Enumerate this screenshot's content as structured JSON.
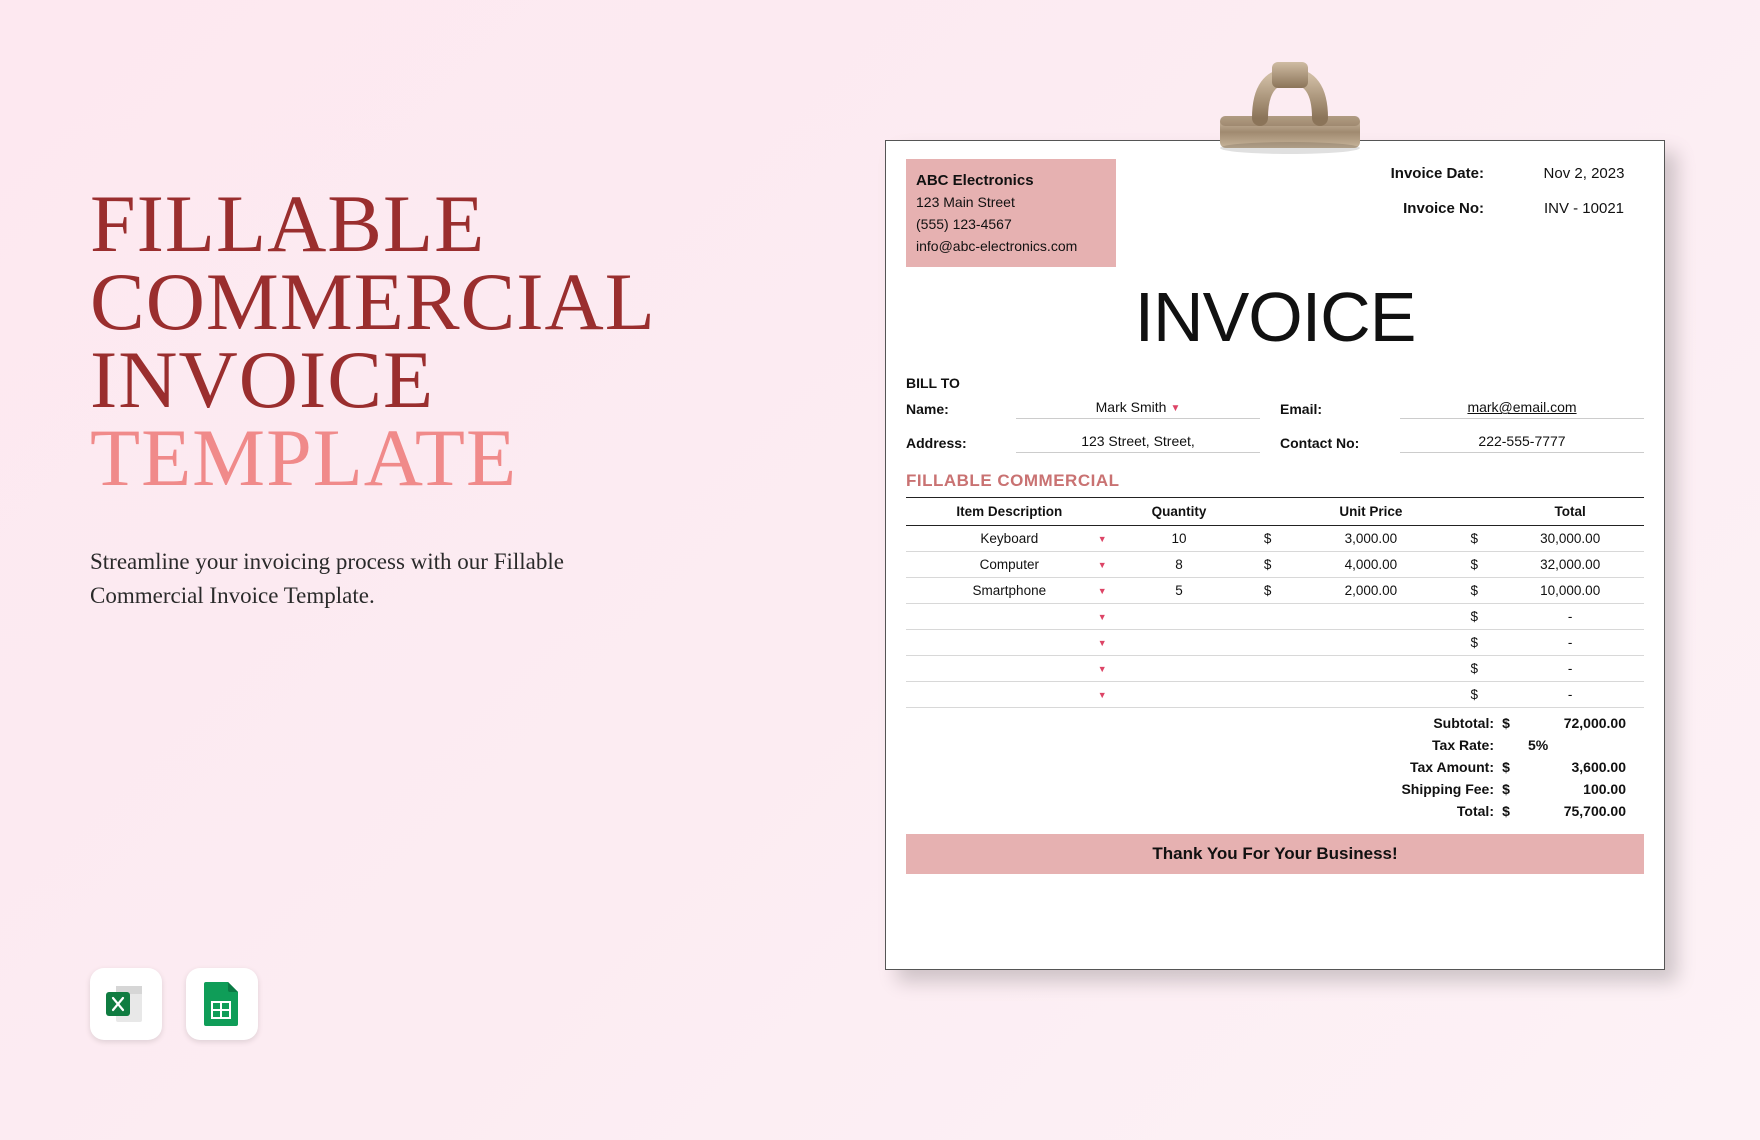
{
  "hero": {
    "line1": "FILLABLE",
    "line2": "COMMERCIAL",
    "line3": "INVOICE",
    "line4": "TEMPLATE",
    "subtitle": "Streamline your invoicing process with our Fillable Commercial Invoice Template."
  },
  "apps": {
    "excel": "excel-icon",
    "sheets": "google-sheets-icon"
  },
  "invoice": {
    "company": {
      "name": "ABC Electronics",
      "street": "123 Main Street",
      "phone": "(555) 123-4567",
      "email": "info@abc-electronics.com"
    },
    "meta": {
      "date_label": "Invoice Date:",
      "date_value": "Nov 2, 2023",
      "no_label": "Invoice No:",
      "no_value": "INV - 10021"
    },
    "big_title": "INVOICE",
    "bill_to_label": "BILL TO",
    "bill_to": {
      "name_label": "Name:",
      "name": "Mark Smith",
      "email_label": "Email:",
      "email": "mark@email.com",
      "address_label": "Address:",
      "address": "123 Street, Street,",
      "contact_label": "Contact No:",
      "contact": "222-555-7777"
    },
    "section_title": "FILLABLE COMMERCIAL",
    "columns": {
      "desc": "Item Description",
      "qty": "Quantity",
      "unit": "Unit Price",
      "total": "Total"
    },
    "items": [
      {
        "desc": "Keyboard",
        "qty": "10",
        "unit": "3,000.00",
        "total": "30,000.00"
      },
      {
        "desc": "Computer",
        "qty": "8",
        "unit": "4,000.00",
        "total": "32,000.00"
      },
      {
        "desc": "Smartphone",
        "qty": "5",
        "unit": "2,000.00",
        "total": "10,000.00"
      },
      {
        "desc": "",
        "qty": "",
        "unit": "",
        "total": "-"
      },
      {
        "desc": "",
        "qty": "",
        "unit": "",
        "total": "-"
      },
      {
        "desc": "",
        "qty": "",
        "unit": "",
        "total": "-"
      },
      {
        "desc": "",
        "qty": "",
        "unit": "",
        "total": "-"
      }
    ],
    "totals": {
      "subtotal_label": "Subtotal:",
      "subtotal": "72,000.00",
      "taxrate_label": "Tax Rate:",
      "taxrate": "5%",
      "taxamt_label": "Tax Amount:",
      "taxamt": "3,600.00",
      "ship_label": "Shipping Fee:",
      "ship": "100.00",
      "total_label": "Total:",
      "total": "75,700.00"
    },
    "thanks": "Thank You For Your Business!"
  }
}
